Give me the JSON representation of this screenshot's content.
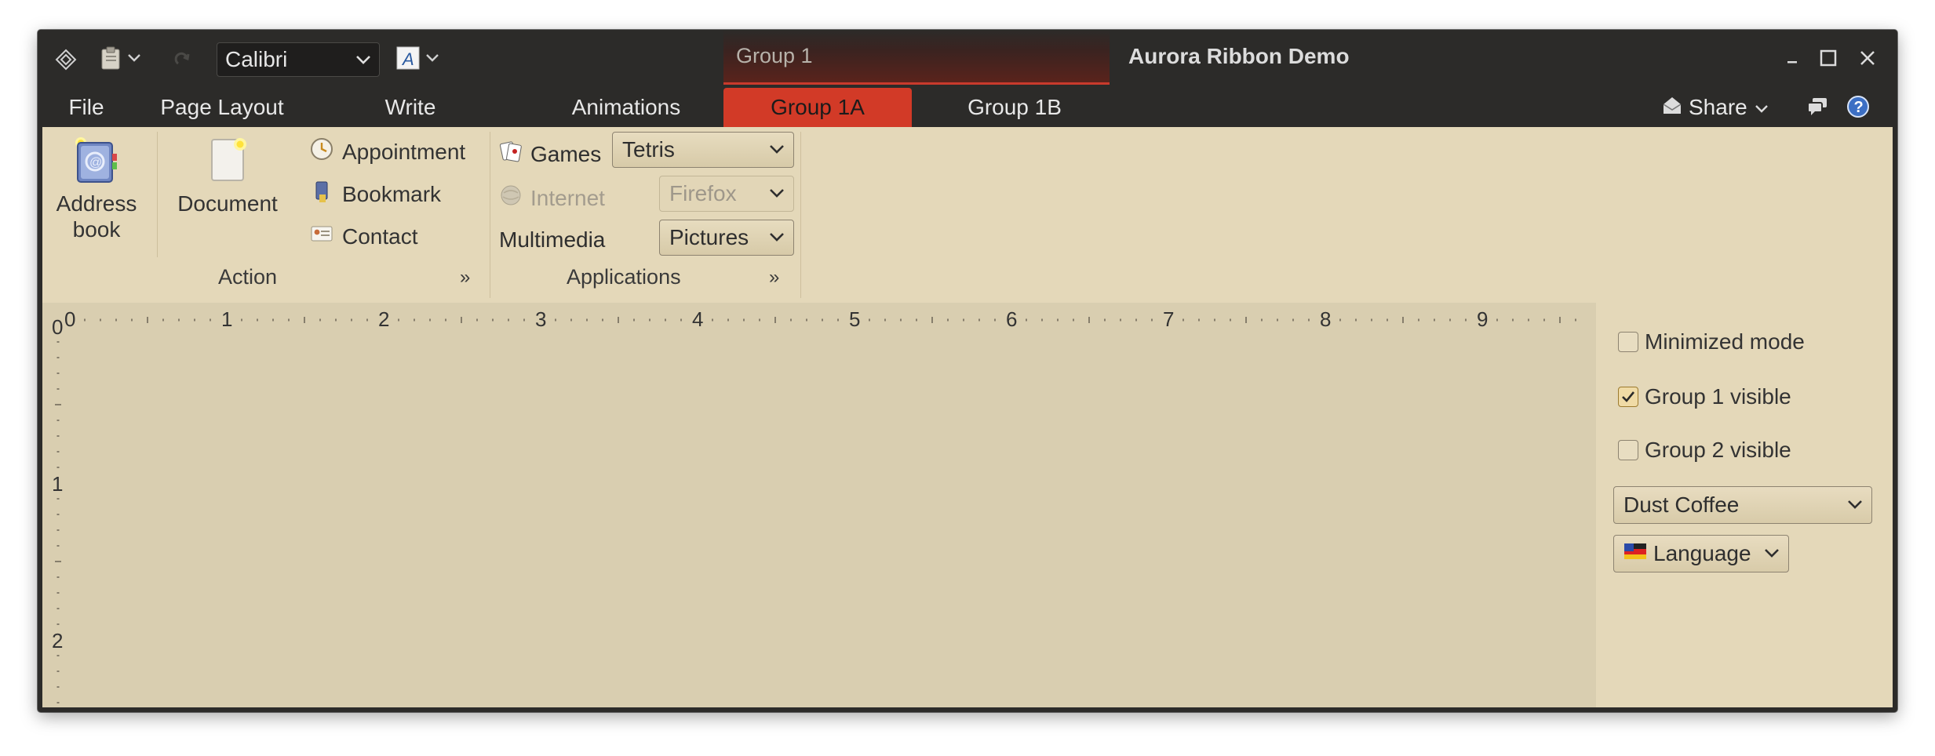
{
  "window": {
    "title": "Aurora Ribbon Demo"
  },
  "qat": {
    "font_name": "Calibri",
    "icons": [
      "app-menu-icon",
      "paste-icon",
      "redo-icon",
      "font-color-icon"
    ]
  },
  "contextual_group": {
    "title": "Group 1"
  },
  "tabs": [
    {
      "label": "File"
    },
    {
      "label": "Page Layout"
    },
    {
      "label": "Write"
    },
    {
      "label": "Animations"
    },
    {
      "label": "Group 1A",
      "selected": true
    },
    {
      "label": "Group 1B"
    }
  ],
  "share": {
    "label": "Share"
  },
  "ribbon": {
    "action": {
      "label": "Action",
      "launcher": "»",
      "address_book": "Address book",
      "document": "Document",
      "appointment": "Appointment",
      "bookmark": "Bookmark",
      "contact": "Contact"
    },
    "applications": {
      "label": "Applications",
      "launcher": "»",
      "games_label": "Games",
      "games_value": "Tetris",
      "internet_label": "Internet",
      "internet_value": "Firefox",
      "multimedia_label": "Multimedia",
      "multimedia_value": "Pictures"
    }
  },
  "ruler": {
    "horizontal_labels": [
      "0",
      "1",
      "2",
      "3",
      "4",
      "5",
      "6",
      "7",
      "8",
      "9"
    ],
    "vertical_labels": [
      "0",
      "1",
      "2"
    ]
  },
  "side_panel": {
    "minimized_mode": {
      "label": "Minimized mode",
      "checked": false
    },
    "group1_visible": {
      "label": "Group 1 visible",
      "checked": true
    },
    "group2_visible": {
      "label": "Group 2 visible",
      "checked": false
    },
    "skin": "Dust Coffee",
    "language": "Language"
  },
  "colors": {
    "titlebar": "#2c2b29",
    "selected_tab": "#d23a27",
    "ribbon_bg": "#e4d8b9",
    "content_bg": "#d9ceb0"
  }
}
